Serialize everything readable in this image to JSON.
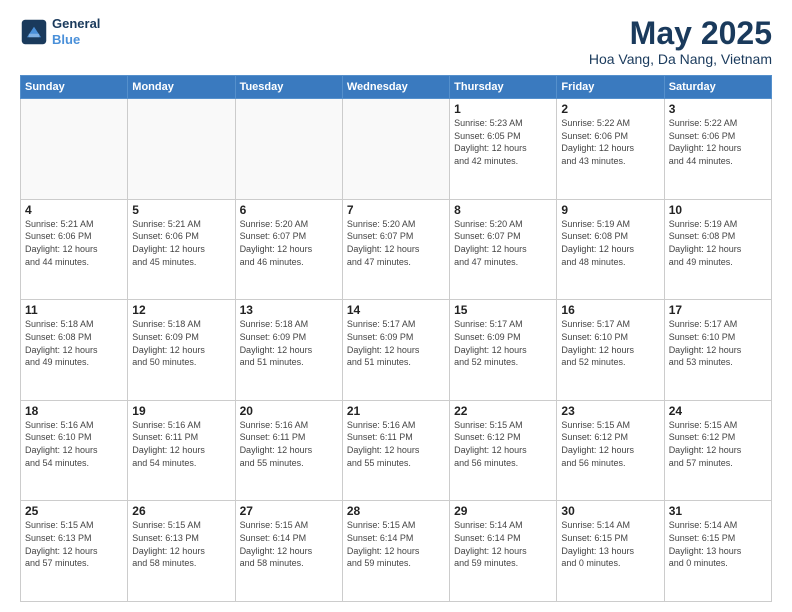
{
  "header": {
    "logo_line1": "General",
    "logo_line2": "Blue",
    "title": "May 2025",
    "subtitle": "Hoa Vang, Da Nang, Vietnam"
  },
  "days_of_week": [
    "Sunday",
    "Monday",
    "Tuesday",
    "Wednesday",
    "Thursday",
    "Friday",
    "Saturday"
  ],
  "weeks": [
    [
      {
        "day": "",
        "info": ""
      },
      {
        "day": "",
        "info": ""
      },
      {
        "day": "",
        "info": ""
      },
      {
        "day": "",
        "info": ""
      },
      {
        "day": "1",
        "info": "Sunrise: 5:23 AM\nSunset: 6:05 PM\nDaylight: 12 hours\nand 42 minutes."
      },
      {
        "day": "2",
        "info": "Sunrise: 5:22 AM\nSunset: 6:06 PM\nDaylight: 12 hours\nand 43 minutes."
      },
      {
        "day": "3",
        "info": "Sunrise: 5:22 AM\nSunset: 6:06 PM\nDaylight: 12 hours\nand 44 minutes."
      }
    ],
    [
      {
        "day": "4",
        "info": "Sunrise: 5:21 AM\nSunset: 6:06 PM\nDaylight: 12 hours\nand 44 minutes."
      },
      {
        "day": "5",
        "info": "Sunrise: 5:21 AM\nSunset: 6:06 PM\nDaylight: 12 hours\nand 45 minutes."
      },
      {
        "day": "6",
        "info": "Sunrise: 5:20 AM\nSunset: 6:07 PM\nDaylight: 12 hours\nand 46 minutes."
      },
      {
        "day": "7",
        "info": "Sunrise: 5:20 AM\nSunset: 6:07 PM\nDaylight: 12 hours\nand 47 minutes."
      },
      {
        "day": "8",
        "info": "Sunrise: 5:20 AM\nSunset: 6:07 PM\nDaylight: 12 hours\nand 47 minutes."
      },
      {
        "day": "9",
        "info": "Sunrise: 5:19 AM\nSunset: 6:08 PM\nDaylight: 12 hours\nand 48 minutes."
      },
      {
        "day": "10",
        "info": "Sunrise: 5:19 AM\nSunset: 6:08 PM\nDaylight: 12 hours\nand 49 minutes."
      }
    ],
    [
      {
        "day": "11",
        "info": "Sunrise: 5:18 AM\nSunset: 6:08 PM\nDaylight: 12 hours\nand 49 minutes."
      },
      {
        "day": "12",
        "info": "Sunrise: 5:18 AM\nSunset: 6:09 PM\nDaylight: 12 hours\nand 50 minutes."
      },
      {
        "day": "13",
        "info": "Sunrise: 5:18 AM\nSunset: 6:09 PM\nDaylight: 12 hours\nand 51 minutes."
      },
      {
        "day": "14",
        "info": "Sunrise: 5:17 AM\nSunset: 6:09 PM\nDaylight: 12 hours\nand 51 minutes."
      },
      {
        "day": "15",
        "info": "Sunrise: 5:17 AM\nSunset: 6:09 PM\nDaylight: 12 hours\nand 52 minutes."
      },
      {
        "day": "16",
        "info": "Sunrise: 5:17 AM\nSunset: 6:10 PM\nDaylight: 12 hours\nand 52 minutes."
      },
      {
        "day": "17",
        "info": "Sunrise: 5:17 AM\nSunset: 6:10 PM\nDaylight: 12 hours\nand 53 minutes."
      }
    ],
    [
      {
        "day": "18",
        "info": "Sunrise: 5:16 AM\nSunset: 6:10 PM\nDaylight: 12 hours\nand 54 minutes."
      },
      {
        "day": "19",
        "info": "Sunrise: 5:16 AM\nSunset: 6:11 PM\nDaylight: 12 hours\nand 54 minutes."
      },
      {
        "day": "20",
        "info": "Sunrise: 5:16 AM\nSunset: 6:11 PM\nDaylight: 12 hours\nand 55 minutes."
      },
      {
        "day": "21",
        "info": "Sunrise: 5:16 AM\nSunset: 6:11 PM\nDaylight: 12 hours\nand 55 minutes."
      },
      {
        "day": "22",
        "info": "Sunrise: 5:15 AM\nSunset: 6:12 PM\nDaylight: 12 hours\nand 56 minutes."
      },
      {
        "day": "23",
        "info": "Sunrise: 5:15 AM\nSunset: 6:12 PM\nDaylight: 12 hours\nand 56 minutes."
      },
      {
        "day": "24",
        "info": "Sunrise: 5:15 AM\nSunset: 6:12 PM\nDaylight: 12 hours\nand 57 minutes."
      }
    ],
    [
      {
        "day": "25",
        "info": "Sunrise: 5:15 AM\nSunset: 6:13 PM\nDaylight: 12 hours\nand 57 minutes."
      },
      {
        "day": "26",
        "info": "Sunrise: 5:15 AM\nSunset: 6:13 PM\nDaylight: 12 hours\nand 58 minutes."
      },
      {
        "day": "27",
        "info": "Sunrise: 5:15 AM\nSunset: 6:14 PM\nDaylight: 12 hours\nand 58 minutes."
      },
      {
        "day": "28",
        "info": "Sunrise: 5:15 AM\nSunset: 6:14 PM\nDaylight: 12 hours\nand 59 minutes."
      },
      {
        "day": "29",
        "info": "Sunrise: 5:14 AM\nSunset: 6:14 PM\nDaylight: 12 hours\nand 59 minutes."
      },
      {
        "day": "30",
        "info": "Sunrise: 5:14 AM\nSunset: 6:15 PM\nDaylight: 13 hours\nand 0 minutes."
      },
      {
        "day": "31",
        "info": "Sunrise: 5:14 AM\nSunset: 6:15 PM\nDaylight: 13 hours\nand 0 minutes."
      }
    ]
  ]
}
